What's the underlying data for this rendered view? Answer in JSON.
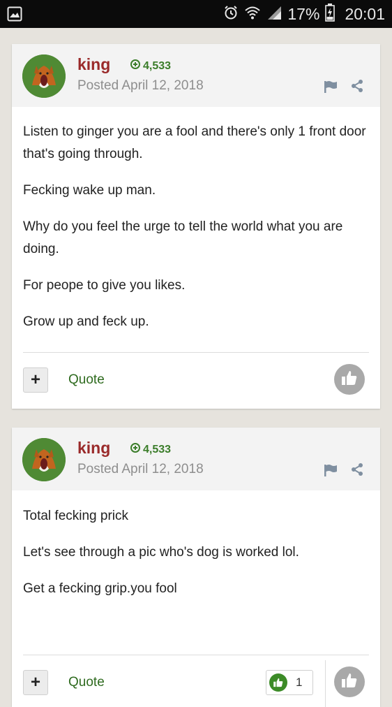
{
  "status_bar": {
    "battery": "17%",
    "time": "20:01",
    "icons": [
      "gallery-icon",
      "alarm-icon",
      "wifi-icon",
      "signal-icon",
      "battery-icon"
    ]
  },
  "posts": [
    {
      "author": "king",
      "reputation": "4,533",
      "posted": "Posted April 12, 2018",
      "paragraphs": [
        "Listen to ginger you are a fool and there's only 1 front door that's going through.",
        "Fecking wake up man.",
        "Why do you feel the urge to tell the world what you are doing.",
        "For peope to give you likes.",
        "Grow up and feck up."
      ],
      "quote_label": "Quote",
      "plus_label": "+"
    },
    {
      "author": "king",
      "reputation": "4,533",
      "posted": "Posted April 12, 2018",
      "paragraphs": [
        "Total fecking prick",
        "Let's see through a pic who's dog is worked lol.",
        "Get a fecking grip.you fool"
      ],
      "quote_label": "Quote",
      "plus_label": "+",
      "reaction_count": "1"
    }
  ],
  "colors": {
    "author": "#9a2a2a",
    "reputation": "#3b7d2a",
    "quote": "#2f6b1f",
    "reaction_green": "#3c8b27"
  }
}
